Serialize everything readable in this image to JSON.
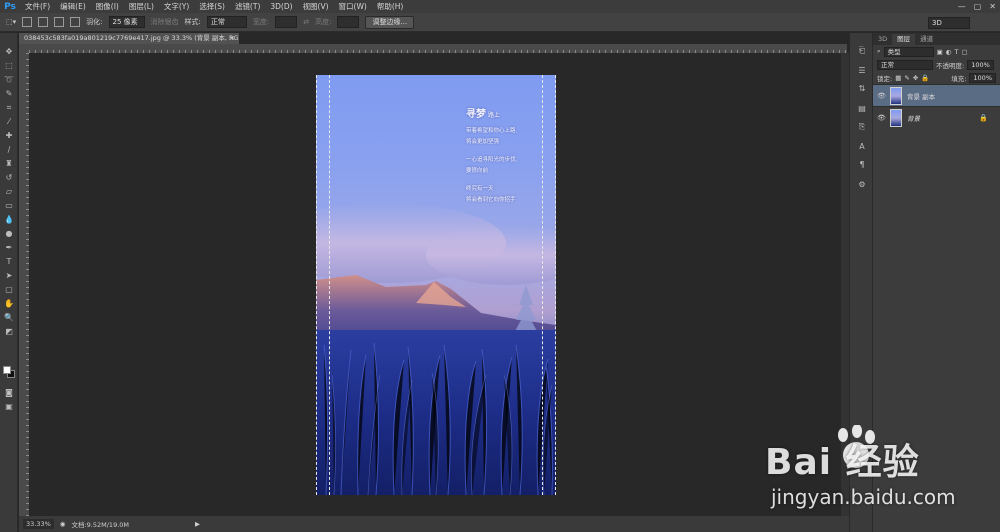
{
  "app": {
    "logo": "Ps"
  },
  "menu": [
    "文件(F)",
    "编辑(E)",
    "图像(I)",
    "图层(L)",
    "文字(Y)",
    "选择(S)",
    "滤镜(T)",
    "3D(D)",
    "视图(V)",
    "窗口(W)",
    "帮助(H)"
  ],
  "window_controls": {
    "minimize": "—",
    "restore": "▢",
    "close": "✕"
  },
  "options": {
    "feather_label": "羽化:",
    "feather_value": "25 像素",
    "antialias_label": "消除锯齿",
    "style_label": "样式:",
    "style_value": "正常",
    "width_label": "宽度:",
    "height_label": "高度:",
    "refine_button": "调整边缘...",
    "workspace": "3D"
  },
  "document": {
    "tab_title": "038453c583fa019a801219c7769e417.jpg @ 33.3% (背景 副本, RGB/8) *",
    "close": "×"
  },
  "poem": {
    "title": "寻梦",
    "title_suffix": "路上",
    "lines": [
      "带着希望和你心上路,",
      "将会更加坚强",
      "",
      "一心追寻阳光的步伐,",
      "要很向前",
      "",
      "终究有一天",
      "将会看到它向你招手"
    ]
  },
  "status": {
    "zoom": "33.33%",
    "doc_info": "文档:9.52M/19.0M",
    "arrow": "▶"
  },
  "layers_panel": {
    "tabs": [
      "3D",
      "图层",
      "通道"
    ],
    "active_tab": "图层",
    "filter_value": "类型",
    "blend_mode": "正常",
    "opacity_label": "不透明度:",
    "opacity_value": "100%",
    "lock_label": "锁定:",
    "fill_label": "填充:",
    "fill_value": "100%",
    "layers": [
      {
        "name": "背景 副本",
        "selected": true,
        "locked": false
      },
      {
        "name": "背景",
        "selected": false,
        "locked": true
      }
    ]
  },
  "watermark": {
    "brand": "Bai  经验",
    "url": "jingyan.baidu.com"
  },
  "colors": {
    "accent": "#2f9cf5",
    "selected_layer": "#5a6b84",
    "sky_top": "#7f9bf1",
    "grass": "#1b2a7a"
  }
}
